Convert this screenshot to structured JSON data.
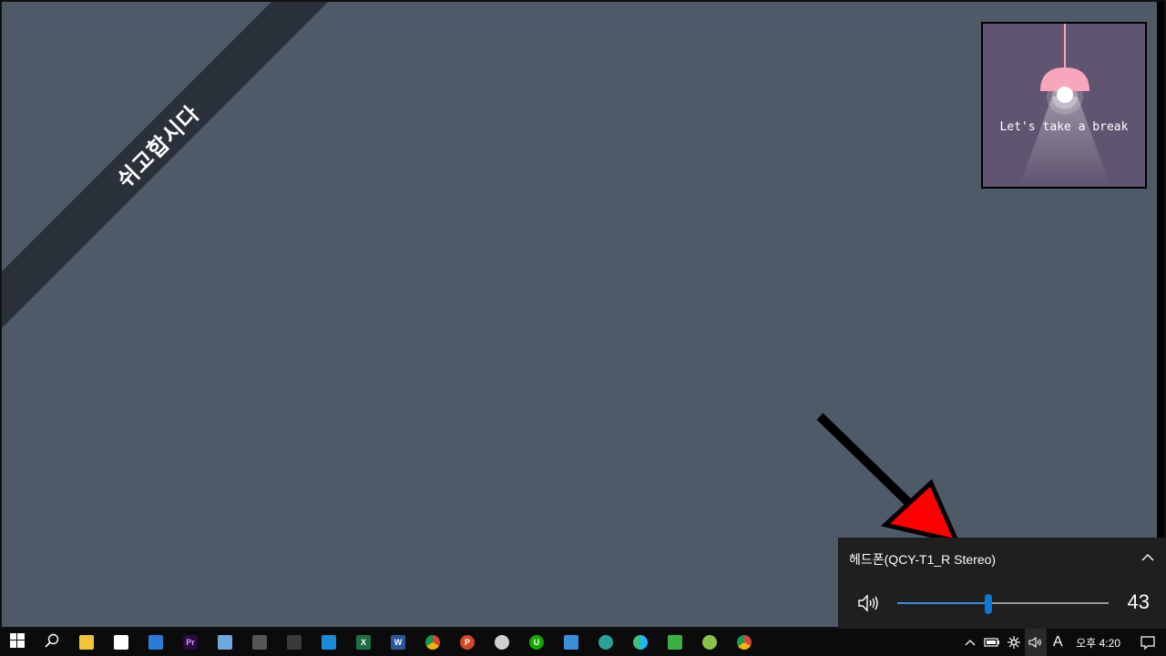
{
  "desktop": {
    "ribbon_text": "쉬고합시다",
    "break_card": {
      "text": "Let's take a break"
    }
  },
  "volume_flyout": {
    "device_name": "헤드폰(QCY-T1_R Stereo)",
    "volume_value": "43",
    "volume_fraction": 0.43,
    "accent": "#0a78d7"
  },
  "taskbar": {
    "apps": [
      {
        "name": "start-icon"
      },
      {
        "name": "search-icon"
      },
      {
        "name": "file-explorer-icon"
      },
      {
        "name": "store-icon"
      },
      {
        "name": "mail-icon"
      },
      {
        "name": "premiere-pro-icon",
        "glyph": "Pr"
      },
      {
        "name": "notes-app-icon"
      },
      {
        "name": "calculator-icon"
      },
      {
        "name": "davinci-icon"
      },
      {
        "name": "teamviewer-icon"
      },
      {
        "name": "excel-icon",
        "glyph": "X"
      },
      {
        "name": "word-icon",
        "glyph": "W"
      },
      {
        "name": "chrome-icon"
      },
      {
        "name": "powerpoint-icon",
        "glyph": "P"
      },
      {
        "name": "kakaotalk-icon"
      },
      {
        "name": "upwork-icon",
        "glyph": "U"
      },
      {
        "name": "remote-desktop-icon"
      },
      {
        "name": "edge-dev-icon"
      },
      {
        "name": "edge-icon"
      },
      {
        "name": "gallery-icon"
      },
      {
        "name": "android-app-icon"
      },
      {
        "name": "chrome-icon-2"
      }
    ],
    "tray": {
      "ime_label": "A",
      "clock": "오후 4:20"
    }
  }
}
